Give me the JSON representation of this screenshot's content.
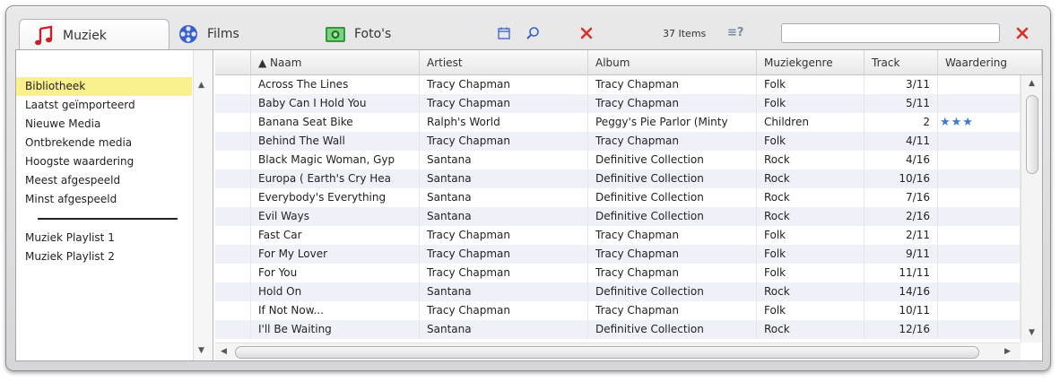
{
  "toolbar": {
    "tabs": [
      {
        "label": "Muziek",
        "icon": "music-note-icon"
      },
      {
        "label": "Films",
        "icon": "film-reel-icon"
      },
      {
        "label": "Foto's",
        "icon": "camera-icon"
      }
    ],
    "items_count": "37 Items",
    "filter_icon": "≡?",
    "search_value": "",
    "colors": {
      "accent_red": "#d8322c",
      "tab_music_red": "#c8202a",
      "films_blue": "#3a5fc8",
      "camera_green": "#2f9a3a"
    }
  },
  "sidebar": {
    "items": [
      {
        "label": "Bibliotheek",
        "selected": true
      },
      {
        "label": "Laatst geïmporteerd"
      },
      {
        "label": "Nieuwe Media"
      },
      {
        "label": "Ontbrekende media"
      },
      {
        "label": "Hoogste waardering"
      },
      {
        "label": "Meest afgespeeld"
      },
      {
        "label": "Minst afgespeeld"
      }
    ],
    "playlists": [
      {
        "label": "Muziek Playlist 1"
      },
      {
        "label": "Muziek Playlist 2"
      }
    ],
    "selected_color": "#fbf08e"
  },
  "table": {
    "columns": [
      "▲  Naam",
      "Artiest",
      "Album",
      "Muziekgenre",
      "Track",
      "Waardering"
    ],
    "rows": [
      {
        "naam": "Across The Lines",
        "artiest": "Tracy Chapman",
        "album": "Tracy Chapman",
        "genre": "Folk",
        "track": "3/11",
        "rating": ""
      },
      {
        "naam": "Baby Can I Hold You",
        "artiest": "Tracy Chapman",
        "album": "Tracy Chapman",
        "genre": "Folk",
        "track": "5/11",
        "rating": ""
      },
      {
        "naam": "Banana Seat Bike",
        "artiest": "Ralph's World",
        "album": "Peggy's Pie Parlor (Minty",
        "genre": "Children",
        "track": "2",
        "rating": "★★★"
      },
      {
        "naam": "Behind The Wall",
        "artiest": "Tracy Chapman",
        "album": "Tracy Chapman",
        "genre": "Folk",
        "track": "4/11",
        "rating": ""
      },
      {
        "naam": "Black Magic Woman, Gyp",
        "artiest": "Santana",
        "album": "Definitive Collection",
        "genre": "Rock",
        "track": "4/16",
        "rating": ""
      },
      {
        "naam": "Europa ( Earth's Cry Hea",
        "artiest": "Santana",
        "album": "Definitive Collection",
        "genre": "Rock",
        "track": "10/16",
        "rating": ""
      },
      {
        "naam": "Everybody's Everything",
        "artiest": "Santana",
        "album": "Definitive Collection",
        "genre": "Rock",
        "track": "7/16",
        "rating": ""
      },
      {
        "naam": "Evil Ways",
        "artiest": "Santana",
        "album": "Definitive Collection",
        "genre": "Rock",
        "track": "2/16",
        "rating": ""
      },
      {
        "naam": "Fast Car",
        "artiest": "Tracy Chapman",
        "album": "Tracy Chapman",
        "genre": "Folk",
        "track": "2/11",
        "rating": ""
      },
      {
        "naam": "For My Lover",
        "artiest": "Tracy Chapman",
        "album": "Tracy Chapman",
        "genre": "Folk",
        "track": "9/11",
        "rating": ""
      },
      {
        "naam": "For You",
        "artiest": "Tracy Chapman",
        "album": "Tracy Chapman",
        "genre": "Folk",
        "track": "11/11",
        "rating": ""
      },
      {
        "naam": "Hold On",
        "artiest": "Santana",
        "album": "Definitive Collection",
        "genre": "Rock",
        "track": "14/16",
        "rating": ""
      },
      {
        "naam": "If Not Now...",
        "artiest": "Tracy Chapman",
        "album": "Tracy Chapman",
        "genre": "Folk",
        "track": "10/11",
        "rating": ""
      },
      {
        "naam": "I'll Be Waiting",
        "artiest": "Santana",
        "album": "Definitive Collection",
        "genre": "Rock",
        "track": "12/16",
        "rating": ""
      }
    ]
  }
}
